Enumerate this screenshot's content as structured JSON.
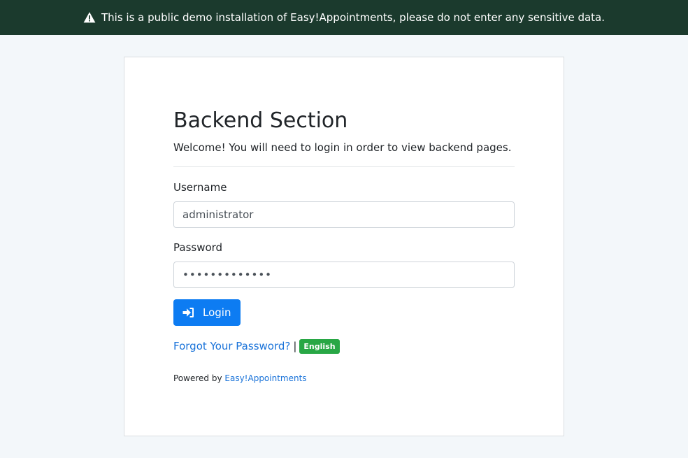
{
  "banner": {
    "icon": "warning-triangle-icon",
    "text": "This is a public demo installation of Easy!Appointments, please do not enter any sensitive data."
  },
  "login": {
    "title": "Backend Section",
    "subtitle": "Welcome! You will need to login in order to view backend pages.",
    "username": {
      "label": "Username",
      "value": "administrator"
    },
    "password": {
      "label": "Password",
      "value": "•••••••••••••"
    },
    "login_button": {
      "icon": "sign-in-icon",
      "label": "Login"
    },
    "forgot_password": "Forgot Your Password?",
    "separator": "|",
    "language": "English",
    "powered_by": "Powered by",
    "powered_link": "Easy!Appointments"
  },
  "colors": {
    "banner_bg": "#1b3a2d",
    "primary": "#0d7cf2",
    "link": "#1a73d9",
    "badge": "#28a745",
    "page_bg": "#f3f7fa"
  }
}
